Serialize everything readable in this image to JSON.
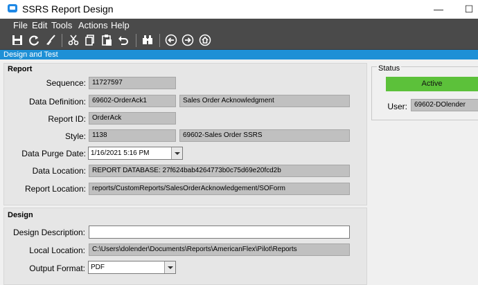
{
  "window": {
    "title": "SSRS Report Design",
    "minimize": "—",
    "maximize": "☐"
  },
  "menu": [
    "File",
    "Edit",
    "Tools",
    "Actions",
    "Help"
  ],
  "tab": {
    "label": "Design and Test"
  },
  "report": {
    "title": "Report",
    "sequence": {
      "label": "Sequence:",
      "value": "11727597"
    },
    "data_definition": {
      "label": "Data Definition:",
      "value": "69602-OrderAck1",
      "description": "Sales Order Acknowledgment"
    },
    "report_id": {
      "label": "Report ID:",
      "value": "OrderAck"
    },
    "style": {
      "label": "Style:",
      "value": "1138",
      "description": "69602-Sales Order SSRS"
    },
    "data_purge_date": {
      "label": "Data Purge Date:",
      "value": "1/16/2021 5:16 PM"
    },
    "data_location": {
      "label": "Data Location:",
      "value": "REPORT DATABASE:  27f624bab4264773b0c75d69e20fcd2b"
    },
    "report_location": {
      "label": "Report Location:",
      "value": "reports/CustomReports/SalesOrderAcknowledgement/SOForm"
    }
  },
  "design": {
    "title": "Design",
    "description": {
      "label": "Design Description:",
      "value": ""
    },
    "local_location": {
      "label": "Local Location:",
      "value": "C:\\Users\\dolender\\Documents\\Reports\\AmericanFlex\\Pilot\\Reports"
    },
    "output_format": {
      "label": "Output Format:",
      "value": "PDF"
    }
  },
  "status": {
    "title": "Status",
    "state": "Active",
    "state_color": "#5cc13a",
    "user_label": "User:",
    "user_value": "69602-DOlender"
  },
  "toolbar_icons": [
    "save-icon",
    "refresh-icon",
    "clear-icon",
    "cut-icon",
    "copy-icon",
    "paste-icon",
    "undo-icon",
    "binoculars-icon",
    "back-icon",
    "forward-icon",
    "home-icon"
  ]
}
